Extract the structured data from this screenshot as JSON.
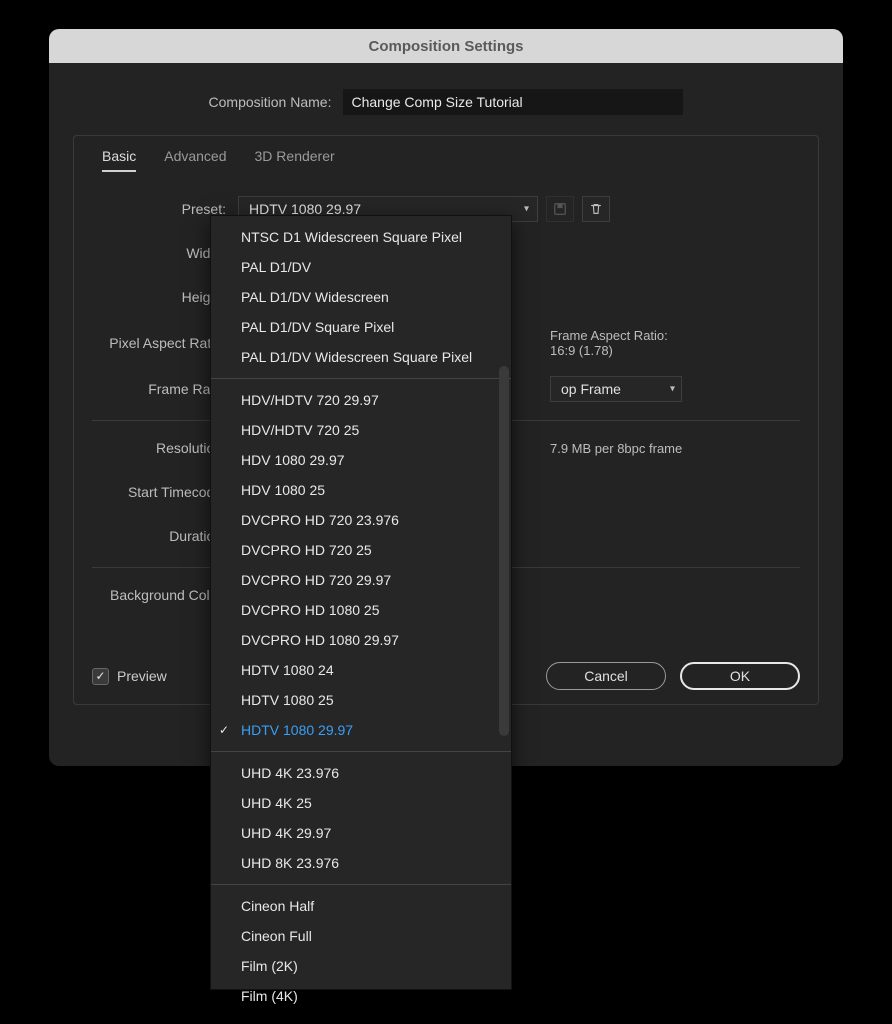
{
  "dialog": {
    "title": "Composition Settings",
    "comp_name_label": "Composition Name:",
    "comp_name_value": "Change Comp Size Tutorial"
  },
  "tabs": {
    "basic": "Basic",
    "advanced": "Advanced",
    "renderer": "3D Renderer",
    "active": "basic"
  },
  "labels": {
    "preset": "Preset:",
    "width": "Width:",
    "height": "Height:",
    "par": "Pixel Aspect Ratio:",
    "frame_rate": "Frame Rate:",
    "resolution": "Resolution:",
    "start_tc": "Start Timecode:",
    "duration": "Duration:",
    "bg": "Background Color:"
  },
  "preset": {
    "selected": "HDTV 1080 29.97",
    "groups": [
      {
        "items": [
          "NTSC D1 Widescreen Square Pixel",
          "PAL D1/DV",
          "PAL D1/DV Widescreen",
          "PAL D1/DV Square Pixel",
          "PAL D1/DV Widescreen Square Pixel"
        ]
      },
      {
        "items": [
          "HDV/HDTV 720 29.97",
          "HDV/HDTV 720 25",
          "HDV 1080 29.97",
          "HDV 1080 25",
          "DVCPRO HD 720 23.976",
          "DVCPRO HD 720 25",
          "DVCPRO HD 720 29.97",
          "DVCPRO HD 1080 25",
          "DVCPRO HD 1080 29.97",
          "HDTV 1080 24",
          "HDTV 1080 25",
          "HDTV 1080 29.97"
        ]
      },
      {
        "items": [
          "UHD 4K 23.976",
          "UHD 4K 25",
          "UHD 4K 29.97",
          "UHD 8K 23.976"
        ]
      },
      {
        "items": [
          "Cineon Half",
          "Cineon Full",
          "Film (2K)",
          "Film (4K)"
        ]
      }
    ]
  },
  "frame_aspect": {
    "label": "Frame Aspect Ratio:",
    "value": "16:9 (1.78)"
  },
  "frame_rate_dropdown": "op Frame",
  "resolution_info": "7.9 MB per 8bpc frame",
  "footer": {
    "preview": "Preview",
    "preview_checked": true,
    "cancel": "Cancel",
    "ok": "OK"
  }
}
